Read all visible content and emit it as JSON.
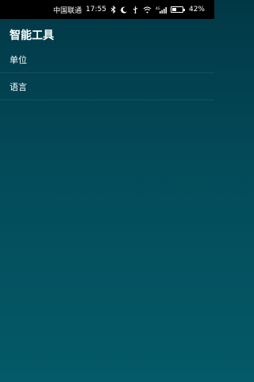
{
  "status_bar": {
    "carrier": "中国联通",
    "time": "17:55",
    "battery_text": "42%",
    "battery_level": 0.42,
    "signal_label": "4G",
    "icons": [
      "bluetooth-icon",
      "moon-icon",
      "usb-icon",
      "wifi-icon",
      "signal-icon",
      "battery-icon"
    ]
  },
  "app": {
    "title": "智能工具"
  },
  "menu": {
    "items": [
      {
        "label": "单位"
      },
      {
        "label": "语言"
      }
    ]
  },
  "colors": {
    "status_bar_bg": "#000000",
    "background_top": "#023846",
    "background_bottom": "#045a68",
    "text": "#ffffff"
  }
}
